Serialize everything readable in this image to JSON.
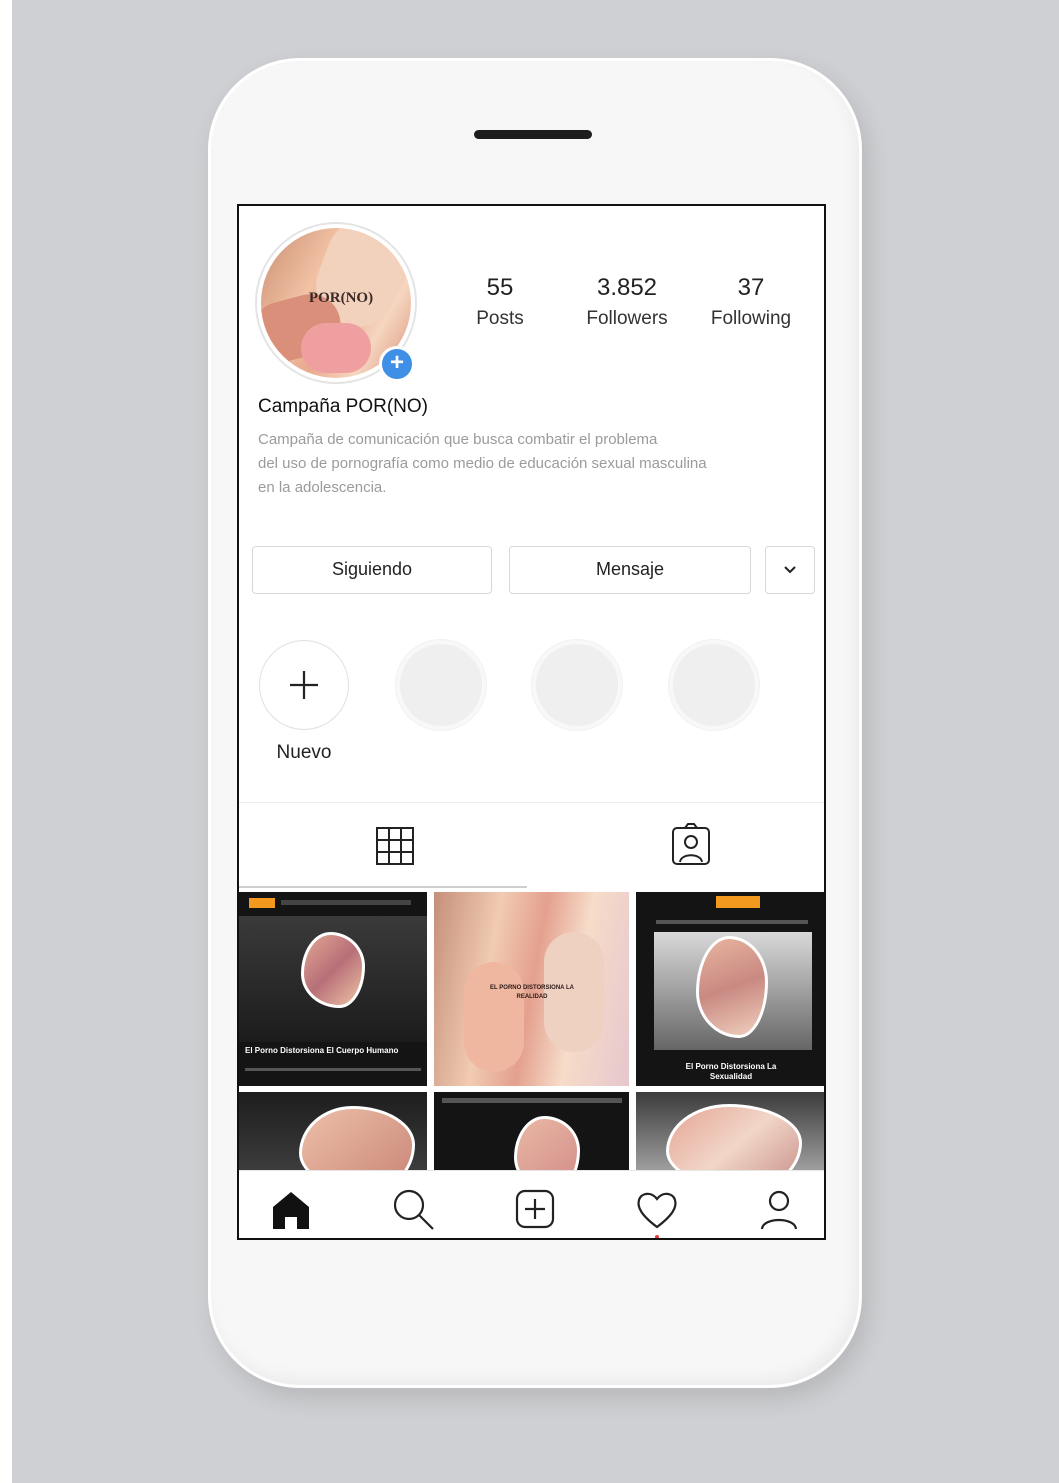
{
  "profile": {
    "avatar_text": "POR(NO)",
    "name": "Campaña POR(NO)",
    "bio_lines": [
      "Campaña de comunicación que busca combatir el problema",
      "del uso de pornografía como medio de educación sexual masculina",
      "en la adolescencia."
    ]
  },
  "stats": [
    {
      "value": "55",
      "label": "Posts"
    },
    {
      "value": "3.852",
      "label": "Followers"
    },
    {
      "value": "37",
      "label": "Following"
    }
  ],
  "actions": {
    "following_label": "Siguiendo",
    "message_label": "Mensaje",
    "more_icon": "chevron-down-icon"
  },
  "highlights": {
    "new_label": "Nuevo"
  },
  "tabs": {
    "grid_icon": "grid-icon",
    "tagged_icon": "tagged-icon"
  },
  "posts": [
    {
      "caption": "El Porno Distorsiona El Cuerpo Humano"
    },
    {
      "caption": "EL PORNO DISTORSIONA LA REALIDAD"
    },
    {
      "caption": "El Porno Distorsiona La Sexualidad"
    }
  ],
  "bottom_nav": [
    "home-icon",
    "search-icon",
    "add-post-icon",
    "activity-heart-icon",
    "profile-icon"
  ],
  "colors": {
    "badge_blue": "#3f8fe6",
    "background_gray": "#cfd0d3"
  }
}
